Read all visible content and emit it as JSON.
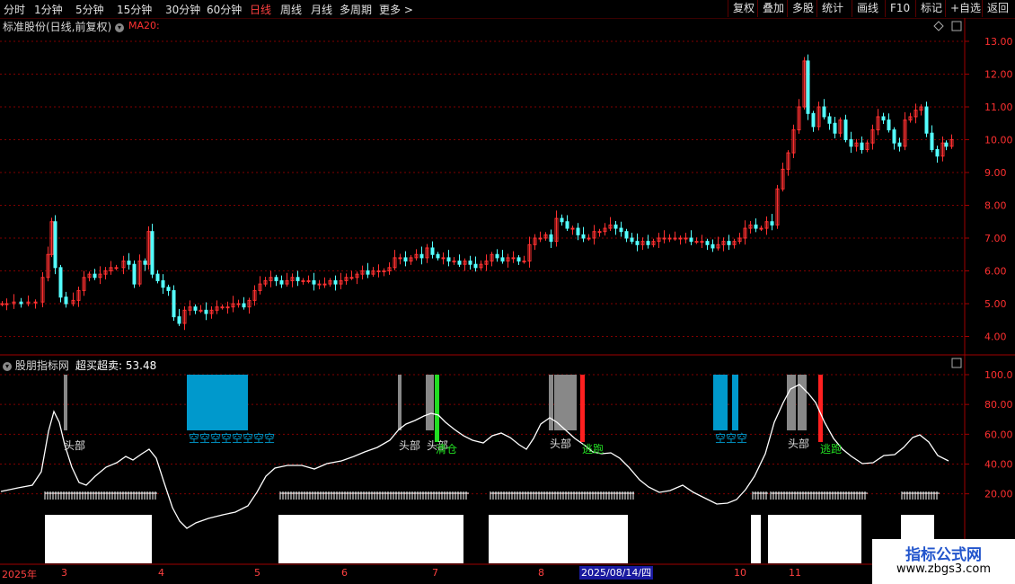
{
  "toolbar": {
    "left": [
      "分时",
      "1分钟",
      "5分钟",
      "15分钟",
      "30分钟",
      "60分钟",
      "日线",
      "周线",
      "月线",
      "多周期",
      "更多 >"
    ],
    "active": "日线",
    "right": [
      "复权",
      "叠加",
      "多股",
      "统计",
      "画线",
      "F10",
      "标记",
      "+自选",
      "返回"
    ]
  },
  "main_chart": {
    "title": "标准股份(日线,前复权)",
    "indicator_label": "MA20:",
    "price_ticks": [
      "13.00",
      "12.00",
      "11.00",
      "10.00",
      "9.00",
      "8.00",
      "7.00",
      "6.00",
      "5.00",
      "4.00"
    ]
  },
  "sub_chart": {
    "title": "股朋指标网",
    "indicator_name": "超买超卖:",
    "indicator_value": "53.48",
    "ticks": [
      "100.0",
      "80.00",
      "60.00",
      "40.00",
      "20.00"
    ],
    "annotations": {
      "head": "头部",
      "head_variant": "头部",
      "empty_position": "空仓",
      "clear": "清仓",
      "escape": "逃跑",
      "buy_zone": "空空空空空空空空",
      "buy_zone_short": "空空空"
    }
  },
  "time_axis": {
    "year": "2025年",
    "months": [
      "3",
      "4",
      "5",
      "6",
      "7",
      "8",
      "10",
      "11"
    ],
    "highlight": "2025/08/14/四"
  },
  "watermark": {
    "line1": "指标公式网",
    "line2": "www.zbgs3.com"
  },
  "colors": {
    "up": "#ff3030",
    "down": "#54ffff",
    "grid": "#800000",
    "oversold_box": "#0099cc",
    "top_box": "#888888",
    "clear_bar": "#22dd22",
    "escape_bar": "#ff2020",
    "line": "#ffffff"
  },
  "chart_data": {
    "type": "candlestick",
    "title": "标准股份(日线,前复权)",
    "ylim": [
      3.6,
      13.3
    ],
    "close_series_approx": [
      [
        1,
        5.0
      ],
      [
        6,
        5.0
      ],
      [
        14,
        5.05
      ],
      [
        22,
        5.0
      ],
      [
        30,
        5.05
      ],
      [
        38,
        5.05
      ],
      [
        46,
        5.8
      ],
      [
        52,
        6.5
      ],
      [
        56,
        7.5
      ],
      [
        60,
        6.1
      ],
      [
        66,
        5.2
      ],
      [
        72,
        5.0
      ],
      [
        80,
        5.1
      ],
      [
        86,
        5.4
      ],
      [
        92,
        5.8
      ],
      [
        98,
        5.9
      ],
      [
        104,
        5.8
      ],
      [
        110,
        5.9
      ],
      [
        116,
        6.0
      ],
      [
        122,
        6.1
      ],
      [
        128,
        6.1
      ],
      [
        136,
        6.3
      ],
      [
        142,
        6.2
      ],
      [
        148,
        5.6
      ],
      [
        154,
        6.3
      ],
      [
        160,
        6.2
      ],
      [
        164,
        7.2
      ],
      [
        168,
        5.9
      ],
      [
        174,
        5.7
      ],
      [
        180,
        5.5
      ],
      [
        186,
        5.4
      ],
      [
        192,
        4.6
      ],
      [
        198,
        4.4
      ],
      [
        204,
        4.8
      ],
      [
        210,
        4.9
      ],
      [
        216,
        4.8
      ],
      [
        222,
        4.8
      ],
      [
        228,
        4.7
      ],
      [
        234,
        4.8
      ],
      [
        240,
        4.9
      ],
      [
        246,
        4.9
      ],
      [
        252,
        4.9
      ],
      [
        258,
        5.0
      ],
      [
        264,
        5.0
      ],
      [
        270,
        4.9
      ],
      [
        276,
        5.1
      ],
      [
        282,
        5.4
      ],
      [
        288,
        5.6
      ],
      [
        294,
        5.7
      ],
      [
        300,
        5.8
      ],
      [
        306,
        5.7
      ],
      [
        312,
        5.6
      ],
      [
        318,
        5.7
      ],
      [
        324,
        5.8
      ],
      [
        330,
        5.7
      ],
      [
        336,
        5.7
      ],
      [
        342,
        5.7
      ],
      [
        348,
        5.6
      ],
      [
        354,
        5.6
      ],
      [
        360,
        5.6
      ],
      [
        366,
        5.7
      ],
      [
        372,
        5.6
      ],
      [
        378,
        5.7
      ],
      [
        384,
        5.8
      ],
      [
        390,
        5.8
      ],
      [
        396,
        5.9
      ],
      [
        402,
        6.0
      ],
      [
        408,
        5.9
      ],
      [
        414,
        6.0
      ],
      [
        420,
        6.0
      ],
      [
        426,
        6.0
      ],
      [
        432,
        6.1
      ],
      [
        438,
        6.4
      ],
      [
        444,
        6.4
      ],
      [
        450,
        6.3
      ],
      [
        456,
        6.4
      ],
      [
        462,
        6.5
      ],
      [
        468,
        6.4
      ],
      [
        474,
        6.7
      ],
      [
        480,
        6.5
      ],
      [
        486,
        6.4
      ],
      [
        492,
        6.4
      ],
      [
        498,
        6.3
      ],
      [
        504,
        6.3
      ],
      [
        510,
        6.2
      ],
      [
        516,
        6.3
      ],
      [
        522,
        6.2
      ],
      [
        528,
        6.1
      ],
      [
        534,
        6.2
      ],
      [
        540,
        6.3
      ],
      [
        546,
        6.5
      ],
      [
        552,
        6.4
      ],
      [
        558,
        6.3
      ],
      [
        564,
        6.4
      ],
      [
        570,
        6.4
      ],
      [
        576,
        6.3
      ],
      [
        582,
        6.3
      ],
      [
        588,
        6.8
      ],
      [
        594,
        7.0
      ],
      [
        600,
        7.0
      ],
      [
        606,
        7.1
      ],
      [
        612,
        6.9
      ],
      [
        618,
        7.6
      ],
      [
        624,
        7.5
      ],
      [
        630,
        7.3
      ],
      [
        636,
        7.3
      ],
      [
        642,
        7.1
      ],
      [
        648,
        7.0
      ],
      [
        654,
        7.0
      ],
      [
        660,
        7.2
      ],
      [
        666,
        7.2
      ],
      [
        672,
        7.3
      ],
      [
        678,
        7.4
      ],
      [
        684,
        7.3
      ],
      [
        690,
        7.2
      ],
      [
        696,
        7.0
      ],
      [
        702,
        6.9
      ],
      [
        708,
        6.8
      ],
      [
        714,
        6.9
      ],
      [
        720,
        6.8
      ],
      [
        726,
        6.9
      ],
      [
        732,
        7.0
      ],
      [
        738,
        7.0
      ],
      [
        744,
        7.0
      ],
      [
        750,
        7.0
      ],
      [
        756,
        7.0
      ],
      [
        762,
        7.0
      ],
      [
        768,
        6.9
      ],
      [
        774,
        6.9
      ],
      [
        780,
        6.9
      ],
      [
        786,
        6.8
      ],
      [
        792,
        6.7
      ],
      [
        798,
        6.8
      ],
      [
        804,
        6.9
      ],
      [
        810,
        6.8
      ],
      [
        816,
        6.9
      ],
      [
        822,
        7.0
      ],
      [
        828,
        7.3
      ],
      [
        834,
        7.4
      ],
      [
        840,
        7.3
      ],
      [
        846,
        7.3
      ],
      [
        852,
        7.5
      ],
      [
        858,
        7.4
      ],
      [
        864,
        8.5
      ],
      [
        870,
        9.1
      ],
      [
        876,
        9.6
      ],
      [
        882,
        10.3
      ],
      [
        888,
        11.0
      ],
      [
        894,
        12.4
      ],
      [
        898,
        10.8
      ],
      [
        904,
        10.4
      ],
      [
        910,
        11.0
      ],
      [
        916,
        10.7
      ],
      [
        922,
        10.5
      ],
      [
        928,
        10.2
      ],
      [
        934,
        10.6
      ],
      [
        940,
        10.0
      ],
      [
        946,
        9.8
      ],
      [
        952,
        9.9
      ],
      [
        958,
        9.7
      ],
      [
        964,
        9.9
      ],
      [
        970,
        10.3
      ],
      [
        976,
        10.7
      ],
      [
        982,
        10.6
      ],
      [
        988,
        10.3
      ],
      [
        994,
        9.9
      ],
      [
        1000,
        9.8
      ],
      [
        1006,
        10.6
      ],
      [
        1012,
        10.7
      ],
      [
        1018,
        10.9
      ],
      [
        1024,
        11.0
      ],
      [
        1030,
        10.2
      ],
      [
        1036,
        9.7
      ],
      [
        1042,
        9.5
      ],
      [
        1048,
        9.9
      ],
      [
        1052,
        9.8
      ],
      [
        1058,
        10.0
      ]
    ]
  }
}
